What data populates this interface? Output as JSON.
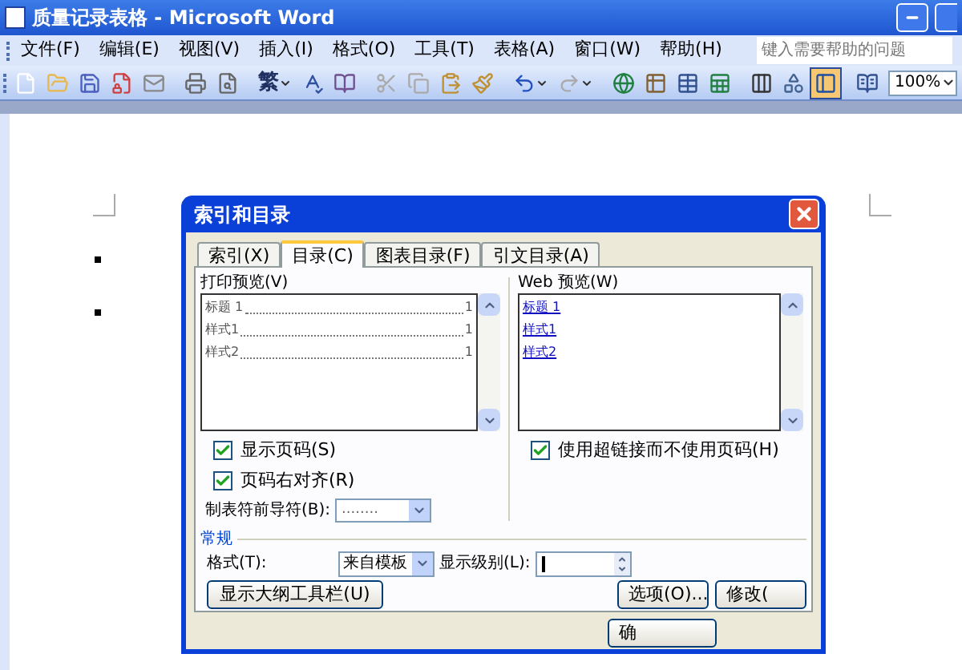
{
  "window": {
    "title": "质量记录表格 - Microsoft Word"
  },
  "menu": [
    {
      "label": "文件(F)"
    },
    {
      "label": "编辑(E)"
    },
    {
      "label": "视图(V)"
    },
    {
      "label": "插入(I)"
    },
    {
      "label": "格式(O)"
    },
    {
      "label": "工具(T)"
    },
    {
      "label": "表格(A)"
    },
    {
      "label": "窗口(W)"
    },
    {
      "label": "帮助(H)"
    }
  ],
  "help_box": {
    "placeholder": "键入需要帮助的问题"
  },
  "toolbar": [
    {
      "kind": "new",
      "disabled": false,
      "pressed": false
    },
    {
      "kind": "open",
      "disabled": false,
      "pressed": false
    },
    {
      "kind": "save",
      "disabled": false,
      "pressed": false
    },
    {
      "kind": "permission",
      "disabled": false,
      "pressed": false
    },
    {
      "kind": "email",
      "disabled": false,
      "pressed": false
    },
    {
      "kind": "separator"
    },
    {
      "kind": "print",
      "disabled": false,
      "pressed": false
    },
    {
      "kind": "preview",
      "disabled": false,
      "pressed": false
    },
    {
      "kind": "separator"
    },
    {
      "kind": "text",
      "label": "繁",
      "dropdown": true,
      "disabled": false,
      "pressed": false
    },
    {
      "kind": "spelling",
      "disabled": false,
      "pressed": false
    },
    {
      "kind": "research",
      "disabled": false,
      "pressed": false
    },
    {
      "kind": "separator"
    },
    {
      "kind": "cut",
      "disabled": true,
      "pressed": false
    },
    {
      "kind": "copy",
      "disabled": true,
      "pressed": false
    },
    {
      "kind": "paste",
      "disabled": false,
      "pressed": false
    },
    {
      "kind": "painter",
      "disabled": false,
      "pressed": false
    },
    {
      "kind": "separator"
    },
    {
      "kind": "undo",
      "dropdown": true,
      "disabled": false,
      "pressed": false
    },
    {
      "kind": "redo",
      "dropdown": true,
      "disabled": true,
      "pressed": false
    },
    {
      "kind": "separator"
    },
    {
      "kind": "hyperlink",
      "disabled": false,
      "pressed": false
    },
    {
      "kind": "borders",
      "disabled": false,
      "pressed": false
    },
    {
      "kind": "table",
      "disabled": false,
      "pressed": false
    },
    {
      "kind": "sheet",
      "disabled": false,
      "pressed": false
    },
    {
      "kind": "separator"
    },
    {
      "kind": "columns",
      "disabled": false,
      "pressed": false
    },
    {
      "kind": "drawing",
      "disabled": false,
      "pressed": false
    },
    {
      "kind": "docmap",
      "disabled": false,
      "pressed": true
    },
    {
      "kind": "separator"
    },
    {
      "kind": "reading",
      "disabled": false,
      "pressed": false
    }
  ],
  "zoom": {
    "value": "100%"
  },
  "dialog": {
    "title": "索引和目录",
    "tabs": [
      {
        "label": "索引(X)",
        "selected": false
      },
      {
        "label": "目录(C)",
        "selected": true
      },
      {
        "label": "图表目录(F)",
        "selected": false
      },
      {
        "label": "引文目录(A)",
        "selected": false
      }
    ],
    "print_preview": {
      "label": "打印预览(V)",
      "lines": [
        {
          "text": "标题 1",
          "page": "1"
        },
        {
          "text": "样式1",
          "page": "1"
        },
        {
          "text": "样式2",
          "page": "1"
        }
      ]
    },
    "web_preview": {
      "label": "Web 预览(W)",
      "links": [
        "标题 1",
        "样式1",
        "样式2"
      ]
    },
    "show_page_numbers": {
      "label": "显示页码(S)",
      "checked": true
    },
    "right_align": {
      "label": "页码右对齐(R)",
      "checked": true
    },
    "use_hyperlinks": {
      "label": "使用超链接而不使用页码(H)",
      "checked": true
    },
    "tab_leader": {
      "label": "制表符前导符(B):",
      "value": "........"
    },
    "general": {
      "heading": "常规",
      "format": {
        "label": "格式(T):",
        "value": "来自模板"
      },
      "levels": {
        "label": "显示级别(L):"
      }
    },
    "buttons": [
      {
        "label": "显示大纲工具栏(U)"
      },
      {
        "label": "选项(O)..."
      },
      {
        "label": "修改("
      },
      {
        "label": "确"
      }
    ]
  }
}
